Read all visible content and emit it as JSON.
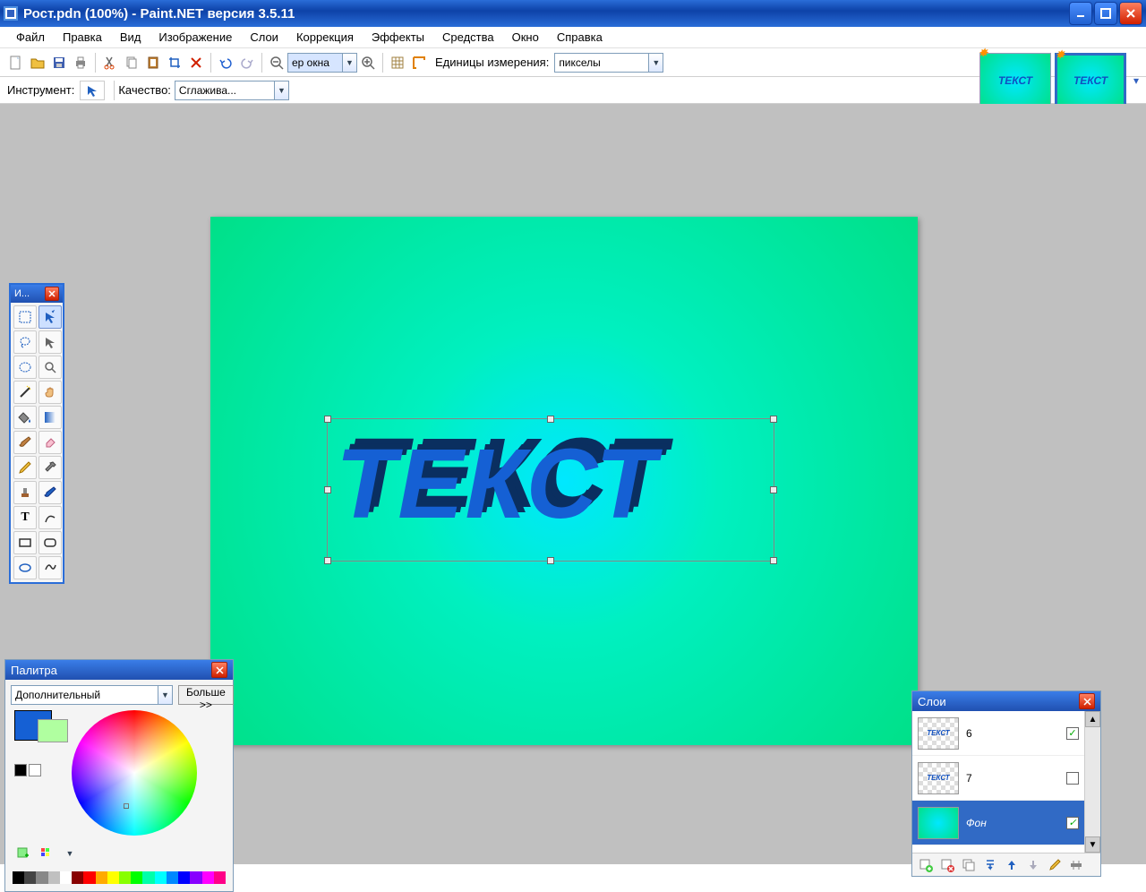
{
  "title": "Рост.pdn (100%) - Paint.NET версия 3.5.11",
  "menu": [
    "Файл",
    "Правка",
    "Вид",
    "Изображение",
    "Слои",
    "Коррекция",
    "Эффекты",
    "Средства",
    "Окно",
    "Справка"
  ],
  "toolbar": {
    "zoom_value": "ер окна",
    "units_label": "Единицы измерения:",
    "units_value": "пикселы"
  },
  "toolrow2": {
    "instrument_label": "Инструмент:",
    "quality_label": "Качество:",
    "quality_value": "Сглажива..."
  },
  "thumbnails": {
    "text": "ТЕКСТ"
  },
  "canvas": {
    "text": "ТЕКСТ"
  },
  "tools_window": {
    "title": "И..."
  },
  "palette": {
    "title": "Палитра",
    "mode": "Дополнительный",
    "more": "Больше >>",
    "primary": "#1560d4",
    "secondary": "#b0ffa0",
    "strip": [
      "#000",
      "#444",
      "#888",
      "#c0c0c0",
      "#fff",
      "#800",
      "#f00",
      "#fa0",
      "#ff0",
      "#8f0",
      "#0f0",
      "#0fa",
      "#0ff",
      "#08f",
      "#00f",
      "#80f",
      "#f0f",
      "#f08"
    ]
  },
  "layers": {
    "title": "Слои",
    "items": [
      {
        "name": "6",
        "thumb_text": "ТЕКСТ",
        "visible": true,
        "bg": false,
        "selected": false
      },
      {
        "name": "7",
        "thumb_text": "ТЕКСТ",
        "visible": false,
        "bg": false,
        "selected": false
      },
      {
        "name": "Фон",
        "thumb_text": "",
        "visible": true,
        "bg": true,
        "selected": true
      }
    ]
  }
}
